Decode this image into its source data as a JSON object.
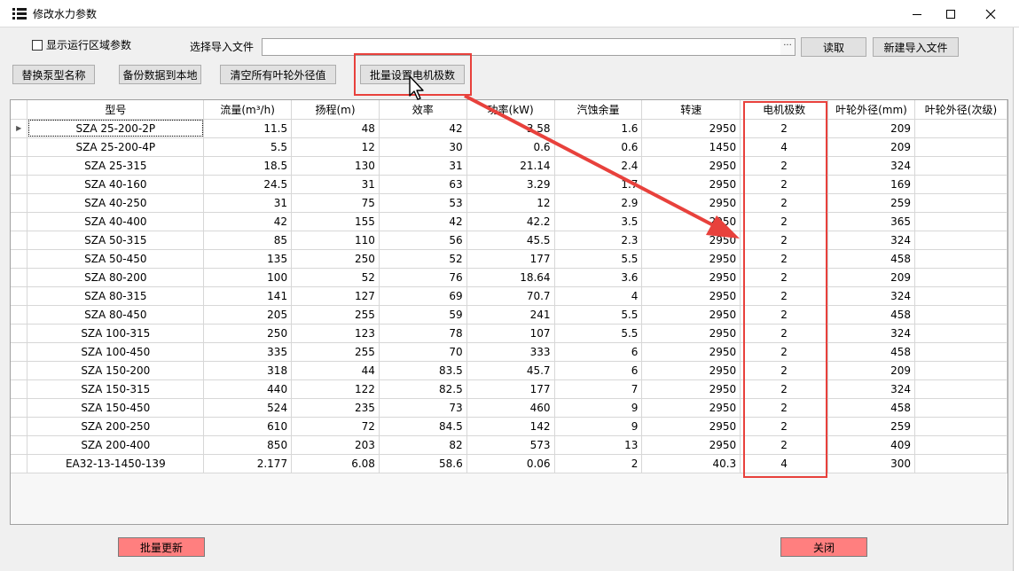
{
  "window": {
    "title": "修改水力参数",
    "icon": "list-icon"
  },
  "toolbar": {
    "show_region_label": "显示运行区域参数",
    "import_file_label": "选择导入文件",
    "file_path_value": "",
    "browse_label": "···",
    "read_label": "读取",
    "new_import_label": "新建导入文件",
    "replace_pump_label": "替换泵型名称",
    "backup_label": "备份数据到本地",
    "clear_impeller_label": "清空所有叶轮外径值",
    "batch_poles_label": "批量设置电机极数"
  },
  "grid": {
    "columns": [
      "型号",
      "流量(m³/h)",
      "扬程(m)",
      "效率",
      "功率(kW)",
      "汽蚀余量",
      "转速",
      "电机极数",
      "叶轮外径(mm)",
      "叶轮外径(次级)"
    ],
    "row_marker": "▶",
    "rows": [
      [
        "SZA 25-200-2P",
        "11.5",
        "48",
        "42",
        "3.58",
        "1.6",
        "2950",
        "2",
        "209",
        ""
      ],
      [
        "SZA 25-200-4P",
        "5.5",
        "12",
        "30",
        "0.6",
        "0.6",
        "1450",
        "4",
        "209",
        ""
      ],
      [
        "SZA 25-315",
        "18.5",
        "130",
        "31",
        "21.14",
        "2.4",
        "2950",
        "2",
        "324",
        ""
      ],
      [
        "SZA 40-160",
        "24.5",
        "31",
        "63",
        "3.29",
        "1.7",
        "2950",
        "2",
        "169",
        ""
      ],
      [
        "SZA 40-250",
        "31",
        "75",
        "53",
        "12",
        "2.9",
        "2950",
        "2",
        "259",
        ""
      ],
      [
        "SZA 40-400",
        "42",
        "155",
        "42",
        "42.2",
        "3.5",
        "2950",
        "2",
        "365",
        ""
      ],
      [
        "SZA 50-315",
        "85",
        "110",
        "56",
        "45.5",
        "2.3",
        "2950",
        "2",
        "324",
        ""
      ],
      [
        "SZA 50-450",
        "135",
        "250",
        "52",
        "177",
        "5.5",
        "2950",
        "2",
        "458",
        ""
      ],
      [
        "SZA 80-200",
        "100",
        "52",
        "76",
        "18.64",
        "3.6",
        "2950",
        "2",
        "209",
        ""
      ],
      [
        "SZA 80-315",
        "141",
        "127",
        "69",
        "70.7",
        "4",
        "2950",
        "2",
        "324",
        ""
      ],
      [
        "SZA 80-450",
        "205",
        "255",
        "59",
        "241",
        "5.5",
        "2950",
        "2",
        "458",
        ""
      ],
      [
        "SZA 100-315",
        "250",
        "123",
        "78",
        "107",
        "5.5",
        "2950",
        "2",
        "324",
        ""
      ],
      [
        "SZA 100-450",
        "335",
        "255",
        "70",
        "333",
        "6",
        "2950",
        "2",
        "458",
        ""
      ],
      [
        "SZA 150-200",
        "318",
        "44",
        "83.5",
        "45.7",
        "6",
        "2950",
        "2",
        "209",
        ""
      ],
      [
        "SZA 150-315",
        "440",
        "122",
        "82.5",
        "177",
        "7",
        "2950",
        "2",
        "324",
        ""
      ],
      [
        "SZA 150-450",
        "524",
        "235",
        "73",
        "460",
        "9",
        "2950",
        "2",
        "458",
        ""
      ],
      [
        "SZA 200-250",
        "610",
        "72",
        "84.5",
        "142",
        "9",
        "2950",
        "2",
        "259",
        ""
      ],
      [
        "SZA 200-400",
        "850",
        "203",
        "82",
        "573",
        "13",
        "2950",
        "2",
        "409",
        ""
      ],
      [
        "EA32-13-1450-139",
        "2.177",
        "6.08",
        "58.6",
        "0.06",
        "2",
        "40.3",
        "4",
        "300",
        ""
      ]
    ]
  },
  "footer": {
    "batch_update_label": "批量更新",
    "close_label": "关闭"
  },
  "colors": {
    "highlight": "#e8413c",
    "action_button": "#ff7f7f"
  }
}
